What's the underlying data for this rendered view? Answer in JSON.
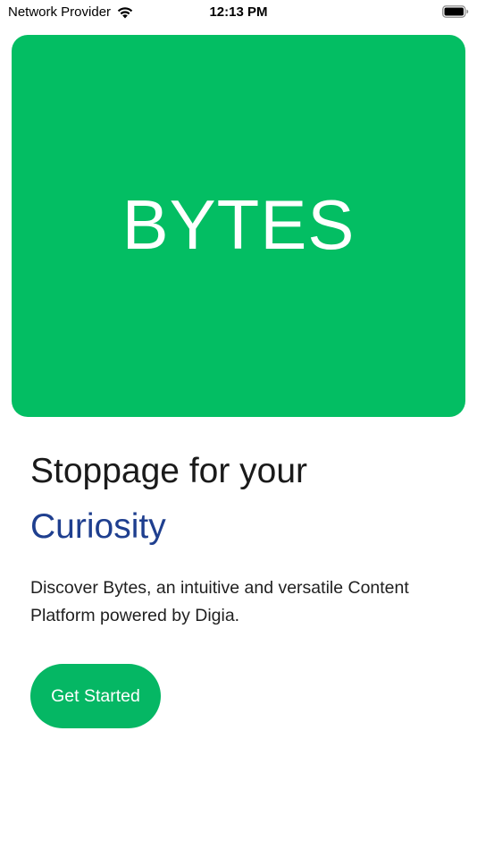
{
  "status_bar": {
    "carrier": "Network Provider",
    "time": "12:13 PM",
    "wifi_icon": "wifi-icon",
    "battery_icon": "battery-icon"
  },
  "hero": {
    "title": "BYTES",
    "background_color": "#03BE63"
  },
  "content": {
    "headline": "Stoppage for your",
    "subheadline": "Curiosity",
    "subheadline_color": "#1F3F8F",
    "description": "Discover Bytes, an intuitive and versatile Content Platform powered by Digia."
  },
  "cta": {
    "label": "Get Started",
    "color": "#05B764"
  }
}
